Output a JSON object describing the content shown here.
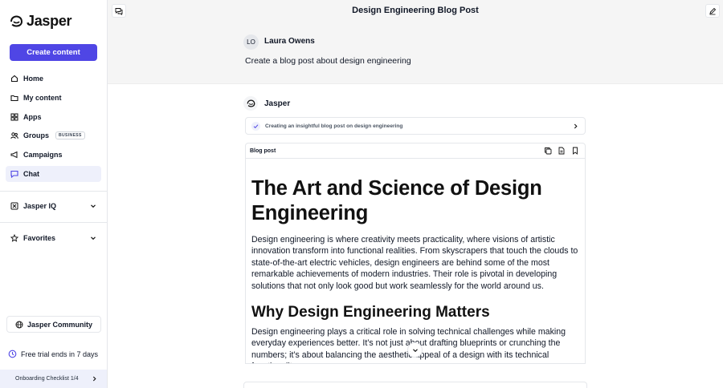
{
  "sidebar": {
    "logo_text": "Jasper",
    "create_label": "Create content",
    "items": [
      {
        "label": "Home",
        "icon": "home-icon"
      },
      {
        "label": "My content",
        "icon": "folder-icon"
      },
      {
        "label": "Apps",
        "icon": "apps-icon"
      },
      {
        "label": "Groups",
        "icon": "users-icon",
        "badge": "BUSINESS"
      },
      {
        "label": "Campaigns",
        "icon": "megaphone-icon"
      },
      {
        "label": "Chat",
        "icon": "chat-icon",
        "active": true
      }
    ],
    "jasper_iq": "Jasper IQ",
    "favorites": "Favorites",
    "community": "Jasper Community",
    "trial": "Free trial ends in 7 days",
    "onboarding": "Onboarding Checklist 1/4"
  },
  "header": {
    "title": "Design Engineering Blog Post"
  },
  "prompt": {
    "avatar_initials": "LO",
    "user_name": "Laura Owens",
    "message": "Create a blog post about design engineering"
  },
  "response": {
    "author": "Jasper",
    "status": "Creating an insightful blog post on design engineering",
    "doc_label": "Blog post",
    "heading1": "The Art and Science of Design Engineering",
    "paragraph1": "Design engineering is where creativity meets practicality, where visions of artistic innovation transform into functional realities. From skyscrapers that touch the clouds to state-of-the-art electric vehicles, design engineers are behind some of the most remarkable achievements of modern industries. Their role is pivotal in developing solutions that not only look good but work seamlessly for the world around us.",
    "heading2": "Why Design Engineering Matters",
    "paragraph2": "Design engineering plays a critical role in solving technical challenges while making everyday experiences better. It’s not just about drafting blueprints or crunching the numbers; it’s about balancing the aesthetic appeal of a design with its technical functionality."
  },
  "colors": {
    "accent": "#4f46e5",
    "active_bg": "#eef0fb",
    "header_bg": "#f5f5f5"
  }
}
